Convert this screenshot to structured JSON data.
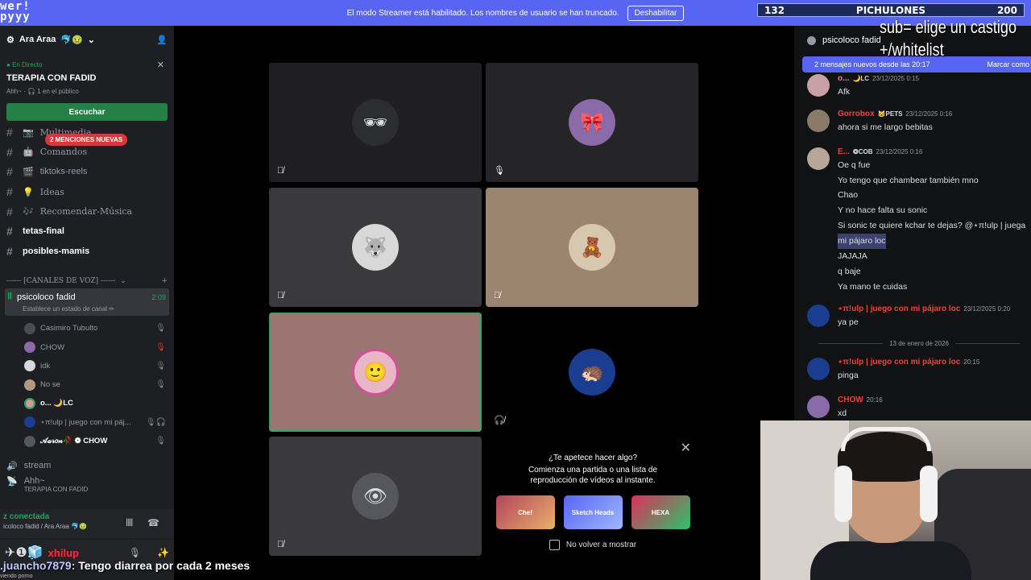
{
  "banner": {
    "logo_line1": "wer!",
    "logo_line2": "pyyy",
    "message": "El modo Streamer está habilitado. Los nombres de usuario se han truncado.",
    "button": "Deshabilitar",
    "counter_left": "132",
    "counter_label": "PICHULONES",
    "counter_right": "200"
  },
  "overlay": {
    "line1": "sub= elige un castigo",
    "line2": "+/whitelist"
  },
  "sidebar": {
    "server_name": "Ara Araa",
    "server_emojis": "🐬🤢",
    "live_tag": "En Directo",
    "live_title": "TERAPIA CON FADID",
    "live_sub": "Ahh~ · 🎧 1 en el público",
    "listen_button": "Escuchar",
    "mentions_badge": "2 MENCIONES NUEVAS",
    "channels": [
      {
        "emoji": "📷",
        "label": "Multimedia",
        "bold": false
      },
      {
        "emoji": "🤖",
        "label": "Comandos",
        "bold": false
      },
      {
        "emoji": "🎬",
        "label": "tiktoks-reels",
        "bold": false
      },
      {
        "emoji": "💡",
        "label": "Ideas",
        "bold": false
      },
      {
        "emoji": "🎶",
        "label": "Recomendar-Música",
        "bold": false
      },
      {
        "emoji": "",
        "label": "tetas-final",
        "bold": true
      },
      {
        "emoji": "",
        "label": "posibles-mamis",
        "bold": true
      }
    ],
    "voice_category": "------ [CANALES DE VOZ] ------",
    "voice_channel": {
      "name": "psicoloco fadid",
      "time": "2:09",
      "status": "Establece un estado de canal ✏"
    },
    "voice_users": [
      {
        "name": "Casimiro Tubulto",
        "color": "#949ba4",
        "icon": "🎙"
      },
      {
        "name": "CHOW",
        "color": "#949ba4",
        "icon": "🎙"
      },
      {
        "name": "idk",
        "color": "#949ba4",
        "icon": "🎙"
      },
      {
        "name": "No se",
        "color": "#949ba4",
        "icon": "🎙"
      },
      {
        "name": "o... 🌙LC",
        "color": "#ffffff",
        "icon": ""
      },
      {
        "name": "⋆π!ulp | juego con mi páj...",
        "color": "#949ba4",
        "icon": "🎙🎧"
      },
      {
        "name": "𝒜𝒶𝓇𝑜𝓃🥀 ❁ CHOW",
        "color": "#ffffff",
        "icon": "🎙"
      }
    ],
    "stream_label": "stream",
    "ahh_name": "Ahh~",
    "ahh_sub": "TERAPIA CON FADID",
    "voice_status": "z conectada",
    "voice_sub": "icoloco fadid / Ara Araa 🐬🤢",
    "user_name": "xhilup",
    "chat_user": ".juancho7879:",
    "chat_text": "Tengo diarrea por cada 2 meses",
    "viewing": "viendo porno"
  },
  "activity": {
    "title": "¿Te apetece hacer algo?",
    "desc": "Comienza una partida o una lista de reproducción de vídeos al instante.",
    "games": [
      "Chef",
      "Sketch Heads",
      "HEXA"
    ],
    "checkbox": "No volver a mostrar"
  },
  "chat": {
    "header": "psicoloco fadid",
    "new_messages": "2 mensajes nuevos desde las 20:17",
    "mark_read": "Marcar como leí",
    "messages": [
      {
        "user": "o...",
        "color": "#ff6b9b",
        "badge": "🌙LC",
        "ts": "23/12/2025 0:15",
        "lines": [
          "Afk"
        ]
      },
      {
        "user": "Gorrobox",
        "color": "#ff3a3a",
        "badge": "🐱PETS",
        "ts": "23/12/2025 0:16",
        "lines": [
          "ahora si me largo bebitas"
        ]
      },
      {
        "user": "E...",
        "color": "#ff3a3a",
        "badge": "❂COB",
        "ts": "23/12/2025 0:16",
        "lines": [
          "Oe q fue",
          "Yo tengo que chambear también mno",
          "Chao",
          "Y no hace falta su sonic",
          "Si sonic te quiere kchar te dejas? @⋆π!ulp | juega",
          "mi pájaro loc",
          "JAJAJA",
          "q baje",
          "Ya mano te cuidas"
        ]
      },
      {
        "user": "⋆π!ulp | juego con mi pájaro loc",
        "color": "#ff3a3a",
        "badge": "",
        "ts": "23/12/2025 0:20",
        "lines": [
          "ya pe"
        ]
      },
      {
        "user": "⋆π!ulp | juego con mi pájaro loc",
        "color": "#ff3a3a",
        "badge": "",
        "ts": "20:15",
        "lines": [
          "pinga"
        ]
      },
      {
        "user": "CHOW",
        "color": "#ff3a3a",
        "badge": "",
        "ts": "20:16",
        "lines": [
          "xd"
        ]
      }
    ],
    "date_divider": "13 de enero de 2026"
  }
}
